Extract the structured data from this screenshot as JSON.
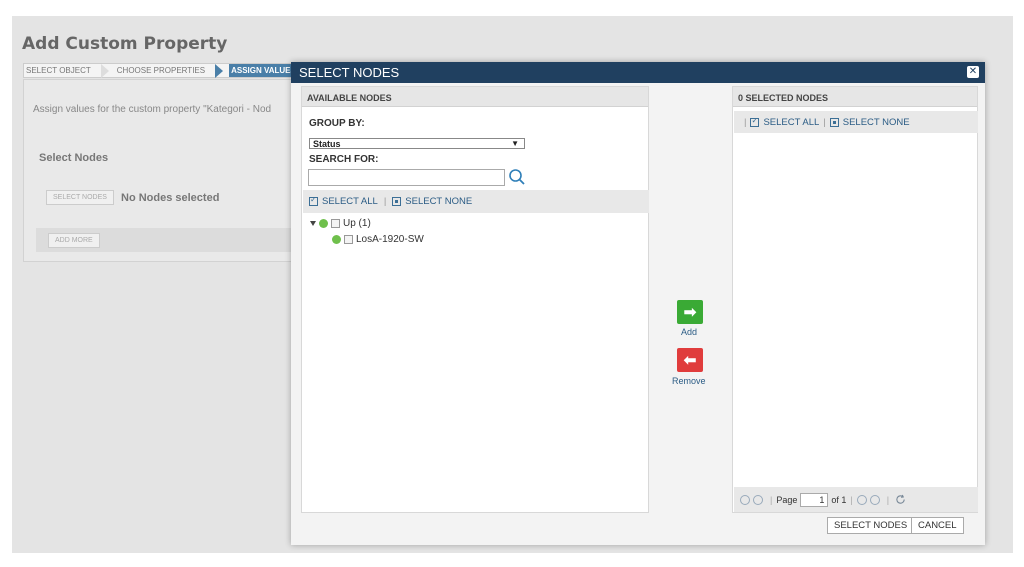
{
  "background": {
    "page_title": "Add Custom Property",
    "wizard_steps": [
      {
        "label": "SELECT OBJECT"
      },
      {
        "label": "CHOOSE PROPERTIES"
      },
      {
        "label": "ASSIGN VALUES"
      }
    ],
    "description": "Assign values for the custom property \"Kategori - Nod",
    "select_nodes_title": "Select Nodes",
    "select_nodes_button": "SELECT NODES",
    "no_nodes_text": "No Nodes selected",
    "add_more_button": "ADD MORE"
  },
  "dialog": {
    "title": "SELECT NODES",
    "close_icon": "close-icon",
    "available": {
      "header": "AVAILABLE NODES",
      "group_by_label": "GROUP BY:",
      "group_by_value": "Status",
      "search_label": "SEARCH FOR:",
      "search_value": "",
      "select_all": "SELECT ALL",
      "select_none": "SELECT NONE",
      "tree": [
        {
          "label": "Up (1)",
          "status": "up",
          "expanded": true,
          "children": [
            {
              "label": "LosA-1920-SW",
              "status": "up"
            }
          ]
        }
      ]
    },
    "add_label": "Add",
    "remove_label": "Remove",
    "selected": {
      "header": "0 SELECTED NODES",
      "select_all": "SELECT ALL",
      "select_none": "SELECT NONE",
      "page_label": "Page",
      "page_value": "1",
      "page_of": "of 1"
    },
    "select_nodes_button": "SELECT NODES",
    "cancel_button": "CANCEL"
  },
  "colors": {
    "header_bg": "#204060",
    "add": "#3aaa35",
    "remove": "#e03c3c",
    "status_up": "#6fc04c",
    "link": "#2b5c85"
  }
}
